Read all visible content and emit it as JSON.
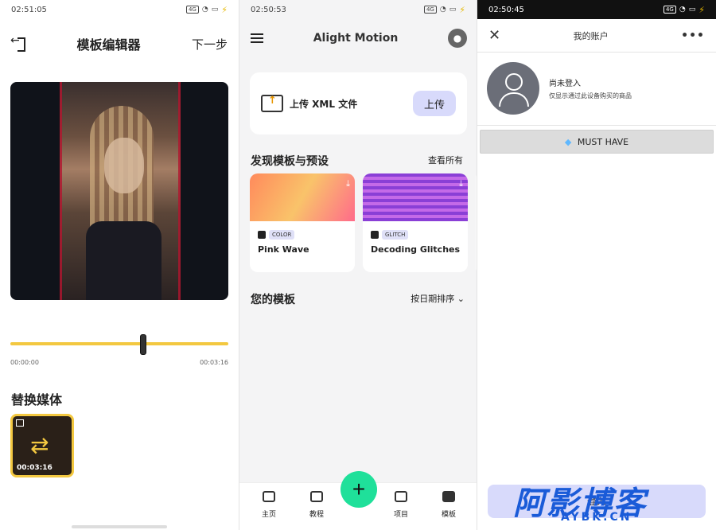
{
  "panel1": {
    "status_time": "02:51:05",
    "title": "模板编辑器",
    "next_label": "下一步",
    "time_start": "00:00:00",
    "time_end": "00:03:16",
    "slider_progress": 0.61,
    "replace_title": "替换媒体",
    "media_duration": "00:03:16"
  },
  "panel2": {
    "status_time": "02:50:53",
    "brand": "Alight Motion",
    "upload_text": "上传 XML 文件",
    "upload_button": "上传",
    "discover_title": "发现模板与预设",
    "see_all": "查看所有",
    "cards": [
      {
        "tag": "COLOR",
        "name": "Pink Wave"
      },
      {
        "tag": "GLITCH",
        "name": "Decoding Glitches"
      }
    ],
    "my_templates": "您的模板",
    "sort_label": "按日期排序",
    "tabs": [
      "主页",
      "教程",
      "项目",
      "模板"
    ]
  },
  "panel3": {
    "status_time": "02:50:45",
    "title": "我的账户",
    "not_logged_in": "尚未登入",
    "note": "仅显示通过此设备购买的商品",
    "must_have": "MUST HAVE",
    "login_label": "登入"
  },
  "watermark": {
    "main": "阿影博客",
    "sub": "AYBK.CN"
  },
  "colors": {
    "accent_yellow": "#f3c840",
    "fab_green": "#1fe09a",
    "button_lavender": "#d8dafb",
    "watermark_blue": "#1a5bd8"
  }
}
